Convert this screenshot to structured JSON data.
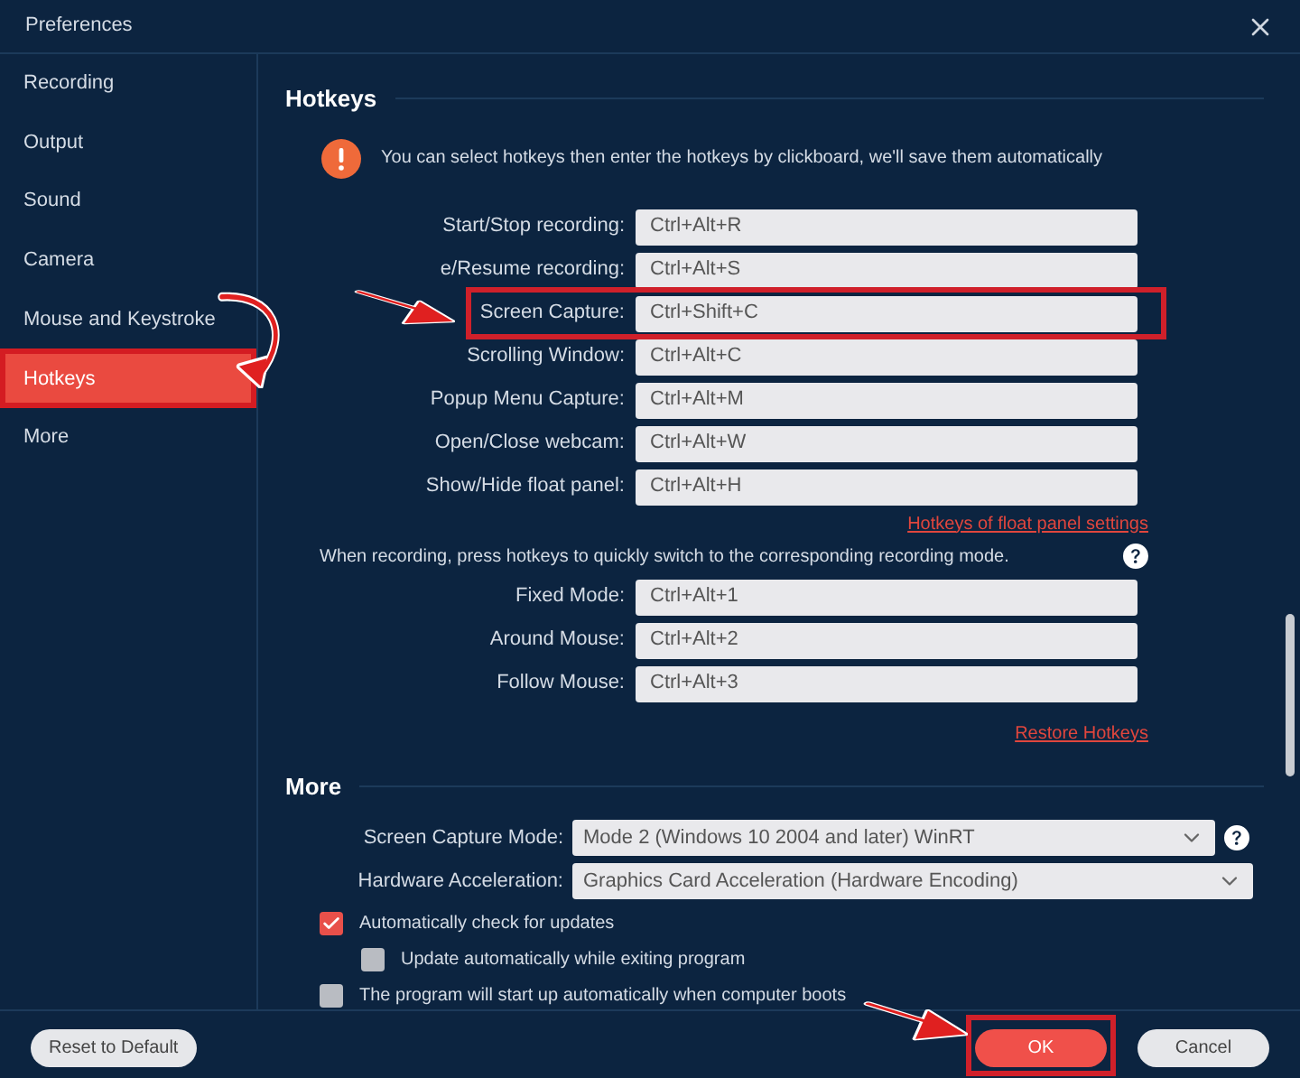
{
  "window": {
    "title": "Preferences"
  },
  "sidebar": {
    "items": [
      {
        "label": "Recording",
        "selected": false
      },
      {
        "label": "Output",
        "selected": false
      },
      {
        "label": "Sound",
        "selected": false
      },
      {
        "label": "Camera",
        "selected": false
      },
      {
        "label": "Mouse and Keystroke",
        "selected": false
      },
      {
        "label": "Hotkeys",
        "selected": true
      },
      {
        "label": "More",
        "selected": false
      }
    ]
  },
  "hotkeys": {
    "title": "Hotkeys",
    "info": "You can select hotkeys then enter the hotkeys by clickboard, we'll save them automatically",
    "items": [
      {
        "label": "Start/Stop recording:",
        "value": "Ctrl+Alt+R",
        "highlighted": false
      },
      {
        "label": "e/Resume recording:",
        "value": "Ctrl+Alt+S",
        "highlighted": false
      },
      {
        "label": "Screen Capture:",
        "value": "Ctrl+Shift+C",
        "highlighted": true
      },
      {
        "label": "Scrolling Window:",
        "value": "Ctrl+Alt+C",
        "highlighted": false
      },
      {
        "label": "Popup Menu Capture:",
        "value": "Ctrl+Alt+M",
        "highlighted": false
      },
      {
        "label": "Open/Close webcam:",
        "value": "Ctrl+Alt+W",
        "highlighted": false
      },
      {
        "label": "Show/Hide float panel:",
        "value": "Ctrl+Alt+H",
        "highlighted": false
      }
    ],
    "float_panel_link": "Hotkeys of float panel settings",
    "mode_note": "When recording, press hotkeys to quickly switch to the corresponding recording mode.",
    "mode_items": [
      {
        "label": "Fixed Mode:",
        "value": "Ctrl+Alt+1",
        "highlighted": false
      },
      {
        "label": "Around Mouse:",
        "value": "Ctrl+Alt+2",
        "highlighted": false
      },
      {
        "label": "Follow Mouse:",
        "value": "Ctrl+Alt+3",
        "highlighted": false
      }
    ],
    "restore_link": "Restore Hotkeys"
  },
  "more": {
    "title": "More",
    "selects": [
      {
        "label": "Screen Capture Mode:",
        "value": "Mode 2 (Windows 10 2004 and later) WinRT",
        "help": true
      },
      {
        "label": "Hardware Acceleration:",
        "value": "Graphics Card Acceleration (Hardware Encoding)",
        "help": false
      }
    ],
    "checkboxes": [
      {
        "label": "Automatically check for updates",
        "checked": true,
        "indented": false
      },
      {
        "label": "Update automatically while exiting program",
        "checked": false,
        "indented": true
      },
      {
        "label": "The program will start up automatically when computer boots",
        "checked": false,
        "indented": false
      }
    ]
  },
  "buttons": [
    {
      "label": "Reset to Default",
      "kind": "default",
      "highlighted": false
    },
    {
      "label": "OK",
      "kind": "primary",
      "highlighted": true
    },
    {
      "label": "Cancel",
      "kind": "default",
      "highlighted": false
    }
  ]
}
